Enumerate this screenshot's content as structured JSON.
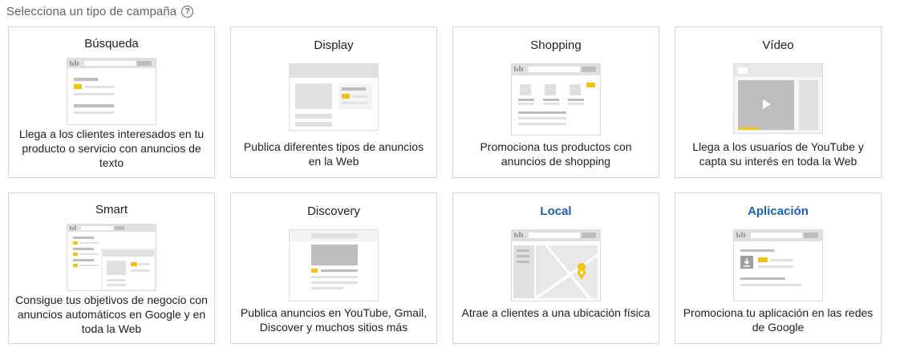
{
  "header": {
    "title": "Selecciona un tipo de campaña",
    "help_icon": "help-circle-icon"
  },
  "cards": [
    {
      "id": "busqueda",
      "title": "Búsqueda",
      "desc": "Llega a los clientes interesados en tu producto o servicio con anuncios de texto"
    },
    {
      "id": "display",
      "title": "Display",
      "desc": "Publica diferentes tipos de anuncios en la Web"
    },
    {
      "id": "shopping",
      "title": "Shopping",
      "desc": "Promociona tus productos con anuncios de shopping"
    },
    {
      "id": "video",
      "title": "Vídeo",
      "desc": "Llega a los usuarios de YouTube y capta su interés en toda la Web"
    },
    {
      "id": "smart",
      "title": "Smart",
      "desc": "Consigue tus objetivos de negocio con anuncios automáticos en Google y en toda la Web"
    },
    {
      "id": "discovery",
      "title": "Discovery",
      "desc": "Publica anuncios en YouTube, Gmail, Discover y muchos sitios más"
    },
    {
      "id": "local",
      "title": "Local",
      "desc": "Atrae a clientes a una ubicación física"
    },
    {
      "id": "aplicacion",
      "title": "Aplicación",
      "desc": "Promociona tu aplicación en las redes de Google"
    }
  ],
  "colors": {
    "accent_yellow": "#f4c20d",
    "link_blue": "#1a5fb4",
    "border": "#d6d6d6"
  }
}
